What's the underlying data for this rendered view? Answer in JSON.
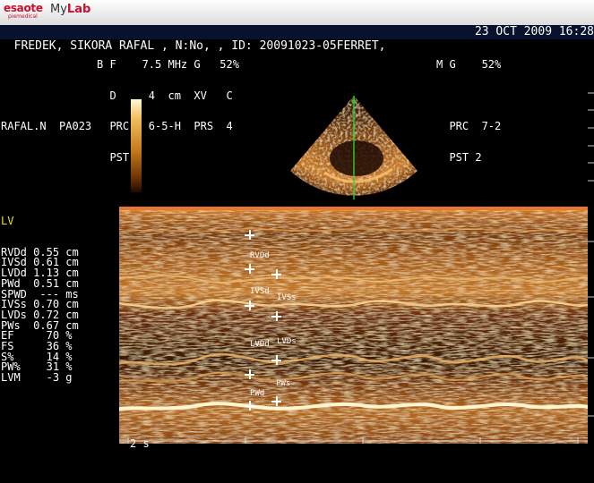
{
  "header": {
    "brand": "esaote",
    "brand_sub": "piemedical",
    "product_a": "My",
    "product_b": "Lab"
  },
  "patient": {
    "info": "FREDEK, SIKORA RAFAL , N:No, , ID: 20091023-05FERRET,",
    "datetime": "23 OCT 2009 16:28"
  },
  "bmode_params": [
    "B F    7.5 MHz G   52%",
    "  D     4  cm  XV   C",
    "  PRC   6-5-H  PRS  4",
    "  PST 2"
  ],
  "mmode_params": [
    "M G    52%",
    "",
    "  PRC  7-2",
    "  PST 2"
  ],
  "operator": "RAFAL.N  PA023",
  "measurements": {
    "group": "LV",
    "rows": [
      {
        "label": "RVDd",
        "value": "0.55",
        "unit": "cm"
      },
      {
        "label": "IVSd",
        "value": "0.61",
        "unit": "cm"
      },
      {
        "label": "LVDd",
        "value": "1.13",
        "unit": "cm"
      },
      {
        "label": "PWd ",
        "value": "0.51",
        "unit": "cm"
      },
      {
        "label": "SPWD",
        "value": " ---",
        "unit": "ms"
      },
      {
        "label": "IVSs",
        "value": "0.70",
        "unit": "cm"
      },
      {
        "label": "LVDs",
        "value": "0.72",
        "unit": "cm"
      },
      {
        "label": "PWs ",
        "value": "0.67",
        "unit": "cm"
      },
      {
        "label": "EF  ",
        "value": "  70",
        "unit": "%"
      },
      {
        "label": "FS  ",
        "value": "  36",
        "unit": "%"
      },
      {
        "label": "S%  ",
        "value": "  14",
        "unit": "%"
      },
      {
        "label": "PW% ",
        "value": "  31",
        "unit": "%"
      },
      {
        "label": "LVM ",
        "value": "  -3",
        "unit": "g"
      }
    ]
  },
  "mmode_labels": {
    "rvdd": "RVDd",
    "ivsd": "IVSd",
    "ivss": "IVSs",
    "lvdd": "LVDd",
    "lvds": "LVDs",
    "pwd": "PWd",
    "pws": "PWs"
  },
  "time_scale": "2 s",
  "colors": {
    "tissue_bright": "#ffe8a0",
    "tissue_mid": "#c87a22",
    "tissue_dark": "#3a1804",
    "cursor_line": "#2bd12b",
    "header_bg": "#08112e",
    "group_label": "#e6e60a"
  }
}
